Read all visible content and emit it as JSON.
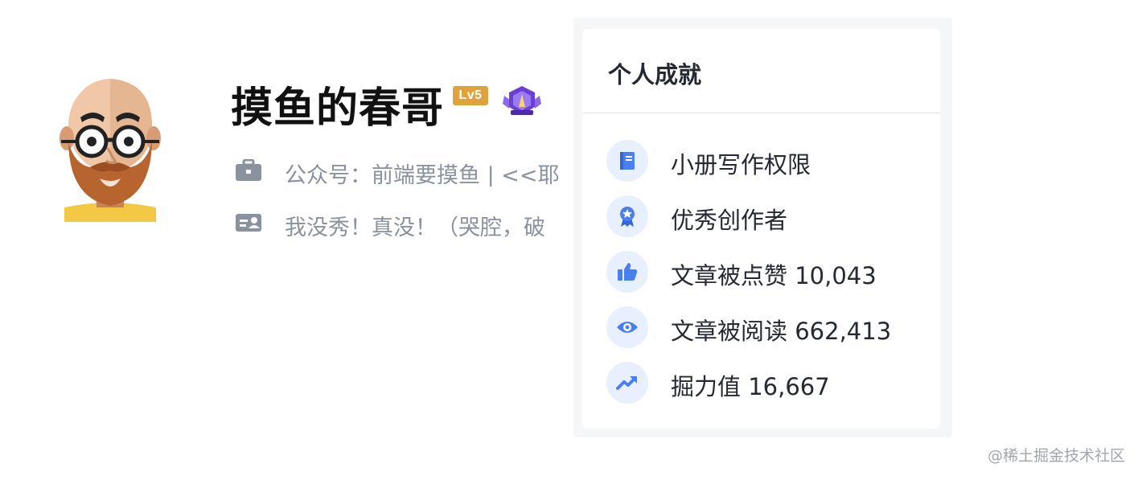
{
  "profile": {
    "username": "摸鱼的春哥",
    "level_badge": "Lv5",
    "company_line": "公众号：前端要摸鱼 | <<耶",
    "description_line": "我没秀！真没！（哭腔，破",
    "icons": [
      "avatar-illustration",
      "medal-icon",
      "briefcase-icon",
      "id-card-icon"
    ]
  },
  "achievements": {
    "title": "个人成就",
    "items": [
      {
        "icon": "book-icon",
        "label": "小册写作权限"
      },
      {
        "icon": "award-icon",
        "label": "优秀创作者"
      },
      {
        "icon": "thumbs-up-icon",
        "label": "文章被点赞 10,043"
      },
      {
        "icon": "eye-icon",
        "label": "文章被阅读 662,413"
      },
      {
        "icon": "trend-icon",
        "label": "掘力值 16,667"
      }
    ]
  },
  "watermark": "@稀土掘金技术社区",
  "colors": {
    "accent_blue": "#4a7ff0",
    "icon_circle_bg": "#e8f0ff",
    "level_badge": "#e0a33c",
    "medal_purple": "#6b3fd1",
    "muted_text": "#8a919f"
  }
}
